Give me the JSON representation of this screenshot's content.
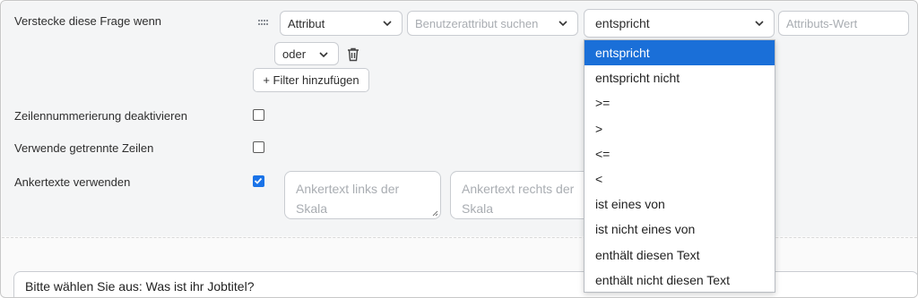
{
  "condition": {
    "label": "Verstecke diese Frage wenn",
    "attribute_select": "Attribut",
    "user_attribute_placeholder": "Benutzerattribut suchen",
    "operator_select": "entspricht",
    "attribute_value_placeholder": "Attributs-Wert",
    "logic_select": "oder",
    "add_filter_label": "+ Filter hinzufügen"
  },
  "operator_options": [
    "entspricht",
    "entspricht nicht",
    ">=",
    ">",
    "<=",
    "<",
    "ist eines von",
    "ist nicht eines von",
    "enthält diesen Text",
    "enthält nicht diesen Text"
  ],
  "selected_operator": "entspricht",
  "settings": {
    "disable_line_numbers_label": "Zeilennummerierung deaktivieren",
    "disable_line_numbers_checked": false,
    "separate_rows_label": "Verwende getrennte Zeilen",
    "separate_rows_checked": false,
    "anchor_texts_label": "Ankertexte verwenden",
    "anchor_texts_checked": true,
    "anchor_left_placeholder": "Ankertext links der Skala",
    "anchor_right_placeholder": "Ankertext rechts der Skala"
  },
  "question": {
    "text": "Bitte wählen Sie aus: Was ist ihr Jobtitel?"
  },
  "colors": {
    "accent": "#1a73e8",
    "selected_option_bg": "#1a6fd8",
    "panel_bg": "#f4f5f6"
  }
}
